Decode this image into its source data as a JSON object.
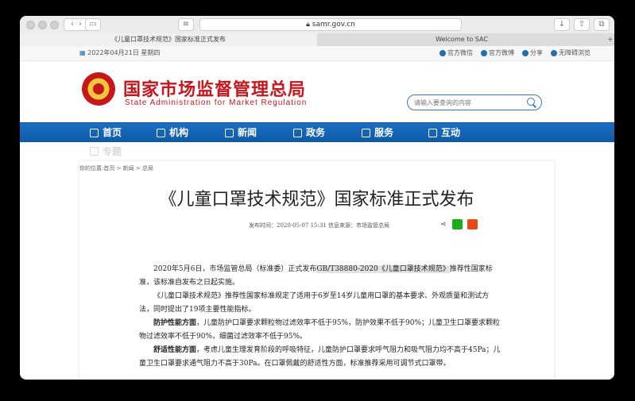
{
  "browser": {
    "address": "samr.gov.cn",
    "tabs": [
      {
        "label": "《儿童口罩技术规范》国家标准正式发布",
        "active": true
      },
      {
        "label": "Welcome to SAC",
        "active": false
      }
    ]
  },
  "topbar": {
    "date": "2022年04月21日 星期四",
    "links": [
      "官方微信",
      "官方微博",
      "分享",
      "无障碍浏览"
    ]
  },
  "header": {
    "cn_title": "国家市场监督管理总局",
    "en_title": "State Administration for Market Regulation",
    "search_placeholder": "请输入要查询的内容"
  },
  "nav": {
    "items": [
      "首页",
      "机构",
      "新闻",
      "政务",
      "服务",
      "互动"
    ],
    "overflow_item": "专题"
  },
  "article": {
    "breadcrumb": "你的位置:首页 > 新闻 > 总局",
    "title": "《儿童口罩技术规范》国家标准正式发布",
    "meta": "发布时间：2020-05-07 15:31    信息来源：市场监管总局",
    "p1_a": "2020年5月6日，市场监管总局（标准委）正式发布",
    "p1_hl": "GB/T38880-2020《儿童口罩技术规范》",
    "p1_b": "推荐性国家标准，该标准自发布之日起实施。",
    "p2": "《儿童口罩技术规范》推荐性国家标准规定了适用于6岁至14岁儿童用口罩的基本要求、外观质量和测试方法，同时提出了19项主要性能指标。",
    "p3_bold": "防护性能方面",
    "p3": "，儿童防护口罩要求颗粒物过滤效率不低于95%，防护效果不低于90%；儿童卫生口罩要求颗粒物过滤效率不低于90%，细菌过滤效率不低于95%。",
    "p4_bold": "舒适性能方面",
    "p4": "，考虑儿童生理发育阶段的呼吸特征，儿童防护口罩要求呼气阻力和吸气阻力均不高于45Pa；儿童卫生口罩要求通气阻力不高于30Pa。在口罩佩戴的舒适性方面，标准推荐采用可调节式口罩带。"
  }
}
